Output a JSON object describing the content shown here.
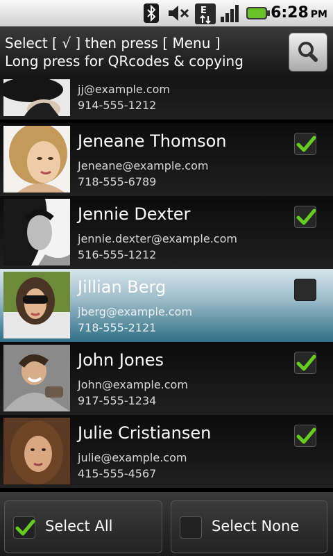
{
  "status_bar": {
    "time": "6:28",
    "ampm": "PM",
    "icons": [
      "bluetooth-icon",
      "mute-icon",
      "edge-data-icon",
      "signal-icon",
      "battery-icon"
    ]
  },
  "header": {
    "line1": "Select [ √ ] then press [ Menu ]",
    "line2": "Long press for QRcodes & copying"
  },
  "contacts": [
    {
      "name": "",
      "email": "jj@example.com",
      "phone": "914-555-1212",
      "checked": false,
      "selected": false
    },
    {
      "name": "Jeneane Thomson",
      "email": "Jeneane@example.com",
      "phone": "718-555-6789",
      "checked": true,
      "selected": false
    },
    {
      "name": "Jennie Dexter",
      "email": "jennie.dexter@example.com",
      "phone": "516-555-1212",
      "checked": true,
      "selected": false
    },
    {
      "name": "Jillian Berg",
      "email": "jberg@example.com",
      "phone": "718-555-2121",
      "checked": false,
      "selected": true
    },
    {
      "name": "John Jones",
      "email": "John@example.com",
      "phone": "917-555-1234",
      "checked": true,
      "selected": false
    },
    {
      "name": "Julie Cristiansen",
      "email": "julie@example.com",
      "phone": "415-555-4567",
      "checked": true,
      "selected": false
    }
  ],
  "bottom": {
    "select_all": "Select All",
    "select_none": "Select None",
    "select_all_checked": true,
    "select_none_checked": false
  },
  "colors": {
    "check_green": "#66cc22",
    "selected_row_top": "#d7e4ea",
    "selected_row_bottom": "#2f6f86"
  }
}
